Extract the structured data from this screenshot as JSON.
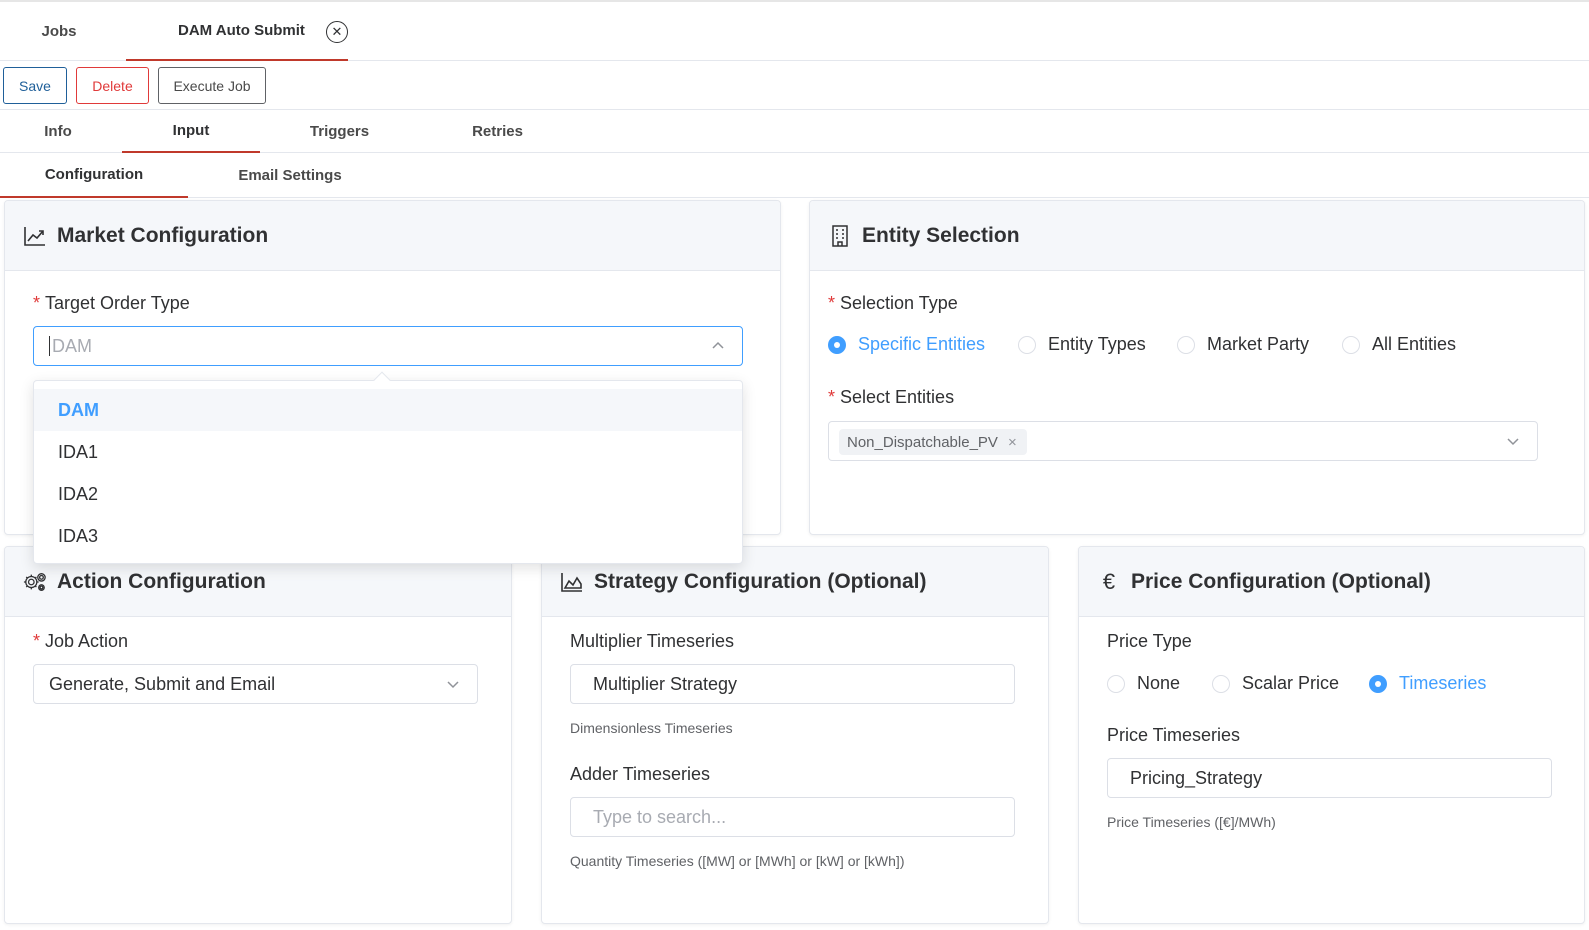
{
  "page_tabs": {
    "jobs": "Jobs",
    "dam": "DAM Auto Submit",
    "close_glyph": "✕"
  },
  "toolbar": {
    "save": "Save",
    "delete": "Delete",
    "execute": "Execute Job"
  },
  "sub_tabs": {
    "info": "Info",
    "input": "Input",
    "triggers": "Triggers",
    "retries": "Retries"
  },
  "inner_tabs": {
    "configuration": "Configuration",
    "email": "Email Settings"
  },
  "market": {
    "title": "Market Configuration",
    "icon": "line-chart-icon",
    "target_label": "Target Order Type",
    "target_value": "DAM",
    "options": [
      "DAM",
      "IDA1",
      "IDA2",
      "IDA3"
    ],
    "selected_option": "DAM"
  },
  "entity": {
    "title": "Entity Selection",
    "icon": "building-icon",
    "selection_label": "Selection Type",
    "radios": [
      "Specific Entities",
      "Entity Types",
      "Market Party",
      "All Entities"
    ],
    "selected_radio": "Specific Entities",
    "select_label": "Select Entities",
    "tag": "Non_Dispatchable_PV",
    "tag_close": "×"
  },
  "action": {
    "title": "Action Configuration",
    "icon": "gears-icon",
    "job_label": "Job Action",
    "job_value": "Generate, Submit and Email"
  },
  "strategy": {
    "title": "Strategy Configuration (Optional)",
    "icon": "area-chart-icon",
    "multiplier_label": "Multiplier Timeseries",
    "multiplier_value": "Multiplier Strategy",
    "multiplier_help": "Dimensionless Timeseries",
    "adder_label": "Adder Timeseries",
    "adder_placeholder": "Type to search...",
    "adder_help": "Quantity Timeseries ([MW] or [MWh] or [kW] or [kWh])"
  },
  "price": {
    "title": "Price Configuration (Optional)",
    "icon": "euro-icon",
    "icon_glyph": "€",
    "type_label": "Price Type",
    "radios": [
      "None",
      "Scalar Price",
      "Timeseries"
    ],
    "selected_radio": "Timeseries",
    "ts_label": "Price Timeseries",
    "ts_value": "Pricing_Strategy",
    "ts_help": "Price Timeseries ([€]/MWh)"
  },
  "colors": {
    "accent": "#409eff",
    "danger": "#e03a3a",
    "save": "#1f5f99",
    "tab_active": "#c0392b"
  }
}
